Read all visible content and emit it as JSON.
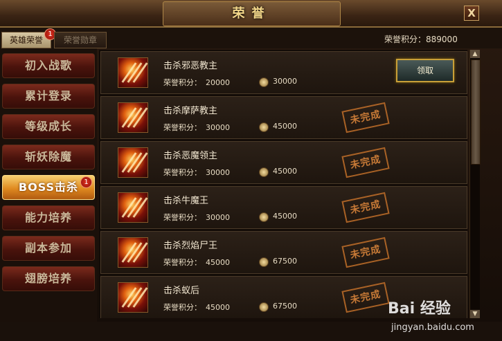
{
  "window": {
    "title": "荣誉",
    "close_label": "X"
  },
  "tabs": [
    {
      "label": "英雄荣誉",
      "badge": "1",
      "active": true
    },
    {
      "label": "荣誉勋章",
      "active": false
    }
  ],
  "honor_points": {
    "label": "荣誉积分：",
    "value": "889000"
  },
  "sidebar": {
    "items": [
      {
        "label": "初入战歌"
      },
      {
        "label": "累计登录"
      },
      {
        "label": "等级成长"
      },
      {
        "label": "斩妖除魔"
      },
      {
        "label": "BOSS击杀",
        "active": true,
        "badge": "1"
      },
      {
        "label": "能力培养"
      },
      {
        "label": "副本参加"
      },
      {
        "label": "翅膀培养"
      }
    ]
  },
  "quests": [
    {
      "name": "击杀邪恶教主",
      "honor_label": "荣誉积分：",
      "honor": "20000",
      "gold": "30000",
      "status": "claim",
      "claim_label": "领取"
    },
    {
      "name": "击杀摩萨教主",
      "honor_label": "荣誉积分：",
      "honor": "30000",
      "gold": "45000",
      "status": "incomplete",
      "stamp": "未完成"
    },
    {
      "name": "击杀恶魔领主",
      "honor_label": "荣誉积分：",
      "honor": "30000",
      "gold": "45000",
      "status": "incomplete",
      "stamp": "未完成"
    },
    {
      "name": "击杀牛魔王",
      "honor_label": "荣誉积分：",
      "honor": "30000",
      "gold": "45000",
      "status": "incomplete",
      "stamp": "未完成"
    },
    {
      "name": "击杀烈焰尸王",
      "honor_label": "荣誉积分：",
      "honor": "45000",
      "gold": "67500",
      "status": "incomplete",
      "stamp": "未完成"
    },
    {
      "name": "击杀蚁后",
      "honor_label": "荣誉积分：",
      "honor": "45000",
      "gold": "67500",
      "status": "incomplete",
      "stamp": "未完成"
    }
  ],
  "icons": {
    "quest_icon": "flame-claw-icon",
    "gold_icon": "coin-icon",
    "scroll_up": "arrow-up-icon",
    "scroll_down": "arrow-down-icon"
  },
  "watermark": {
    "text": "Bai 经验",
    "sub": "jingyan.baidu.com"
  }
}
